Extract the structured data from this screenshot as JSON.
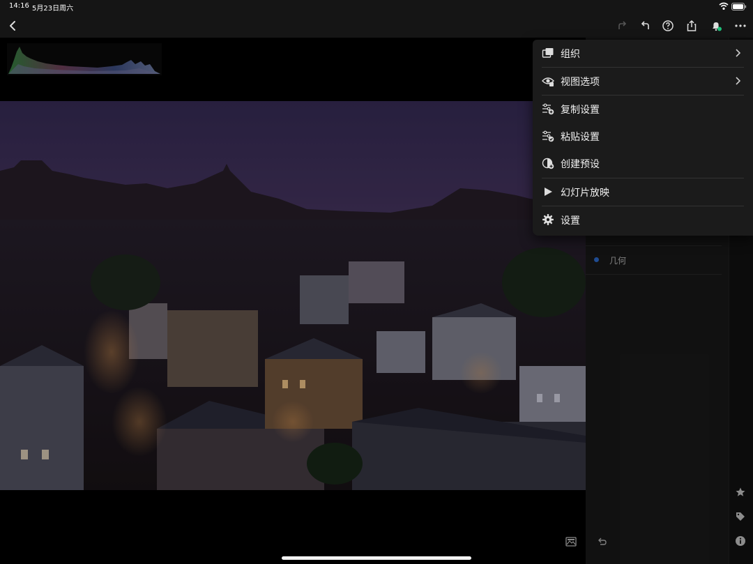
{
  "status_bar": {
    "time": "14:16",
    "date": "5月23日周六"
  },
  "right_panel": {
    "items": [
      {
        "label": "几何"
      }
    ]
  },
  "menu": {
    "items": [
      {
        "label": "组织",
        "icon": "organize-icon",
        "has_submenu": true
      },
      {
        "label": "视图选项",
        "icon": "view-options-icon",
        "has_submenu": true
      },
      {
        "label": "复制设置",
        "icon": "copy-settings-icon",
        "has_submenu": false
      },
      {
        "label": "粘贴设置",
        "icon": "paste-settings-icon",
        "has_submenu": false
      },
      {
        "label": "创建预设",
        "icon": "create-preset-icon",
        "has_submenu": false
      },
      {
        "label": "幻灯片放映",
        "icon": "slideshow-play-icon",
        "has_submenu": false
      },
      {
        "label": "设置",
        "icon": "gear-icon",
        "has_submenu": false
      }
    ]
  },
  "colors": {
    "accent_blue": "#2f6fd6",
    "notification_dot": "#1fbf7a",
    "menu_bg": "#1b1b1b"
  }
}
